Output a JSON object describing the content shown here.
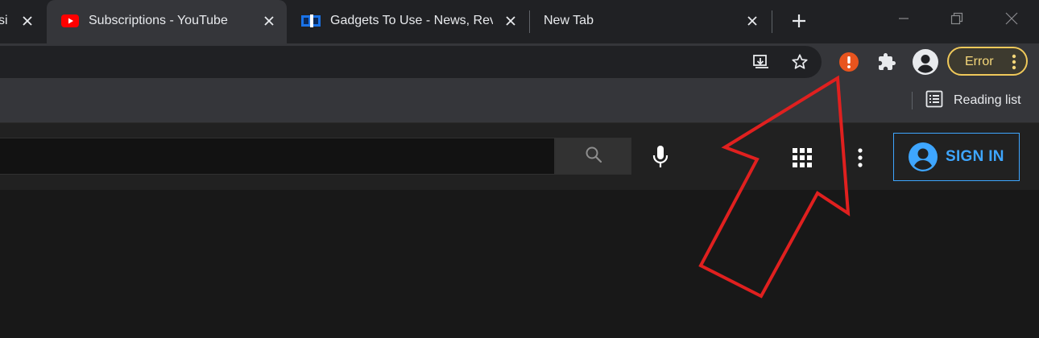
{
  "tabs": [
    {
      "title": "si",
      "favicon": "none",
      "active": false
    },
    {
      "title": "Subscriptions - YouTube",
      "favicon": "youtube-icon",
      "active": true
    },
    {
      "title": "Gadgets To Use - News, Rev",
      "favicon": "gadgets-to-use-icon",
      "active": false
    },
    {
      "title": "New Tab",
      "favicon": "none",
      "active": false
    }
  ],
  "toolbar": {
    "error_label": "Error",
    "icons": [
      "install-app-icon",
      "bookmark-star-icon",
      "extension-error-icon",
      "extensions-puzzle-icon",
      "profile-avatar-icon",
      "kebab-menu-icon"
    ]
  },
  "bookmarks_bar": {
    "reading_list_label": "Reading list"
  },
  "youtube": {
    "sign_in_label": "SIGN IN",
    "icons": [
      "search-icon",
      "microphone-icon",
      "apps-grid-icon",
      "more-vert-icon",
      "account-circle-icon"
    ]
  },
  "colors": {
    "error_badge": "#e8541e",
    "error_chip_border": "#f0c95a",
    "youtube_red": "#ff0000",
    "sign_in_blue": "#3ea6ff",
    "annotation_arrow": "#e0201f"
  }
}
